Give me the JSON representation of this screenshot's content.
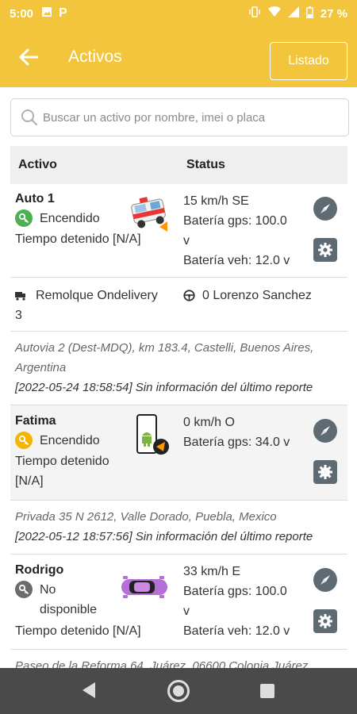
{
  "status_bar": {
    "time": "5:00",
    "battery": "27 %"
  },
  "app_bar": {
    "title": "Activos",
    "listado_label": "Listado"
  },
  "search": {
    "placeholder": "Buscar un activo por nombre, imei o placa"
  },
  "table_header": {
    "col_asset": "Activo",
    "col_status": "Status"
  },
  "assets": [
    {
      "name": "Auto 1",
      "state": "Encendido",
      "state_color": "#4caf50",
      "stopped": "Tiempo detenido [N/A]",
      "status_lines": [
        "15 km/h SE",
        "Batería gps: 100.0",
        "v",
        "Batería veh: 12.0 v"
      ],
      "trailer": "Remolque Ondelivery",
      "trailer_line2": "3",
      "driver": "0 Lorenzo Sanchez",
      "address": "Autovia 2 (Dest-MDQ), km 183.4, Castelli, Buenos Aires, Argentina",
      "report": "[2022-05-24 18:58:54] Sin información del último reporte"
    },
    {
      "name": "Fatima",
      "state": "Encendido",
      "state_color": "#f5b400",
      "stopped": "Tiempo detenido",
      "stopped_line2": "[N/A]",
      "status_lines": [
        "0 km/h O",
        "Batería gps: 34.0 v"
      ],
      "address": "Privada 35 N 2612, Valle Dorado, Puebla, Mexico",
      "report": "[2022-05-12 18:57:56] Sin información del último reporte"
    },
    {
      "name": "Rodrigo",
      "state": "No",
      "state_line2": "disponible",
      "state_color": "#6b6b6b",
      "stopped": "Tiempo detenido [N/A]",
      "status_lines": [
        "33 km/h E",
        "Batería gps: 100.0",
        "v",
        "Batería veh: 12.0 v"
      ],
      "address_partial": "Paseo de la Reforma 64, Juárez, 06600 Colonia Juárez"
    }
  ],
  "icons": {
    "back": "arrow-left-icon",
    "search": "search-icon",
    "navigate": "compass-icon",
    "settings": "gear-icon",
    "key": "key-icon",
    "truck": "truck-icon",
    "steering": "steering-wheel-icon"
  }
}
